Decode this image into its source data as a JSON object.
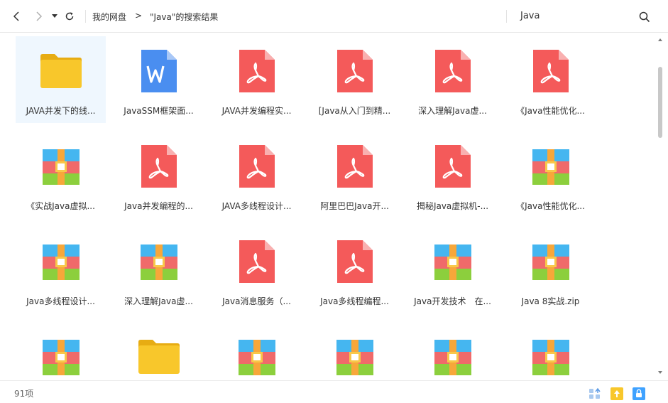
{
  "toolbar": {
    "back_icon": "chevron-left-icon",
    "forward_icon": "chevron-right-icon",
    "history_icon": "caret-down-icon",
    "refresh_icon": "refresh-icon"
  },
  "breadcrumb": {
    "root": "我的网盘",
    "separator": ">",
    "current": "\"Java\"的搜索结果"
  },
  "search": {
    "value": "Java",
    "icon": "search-icon"
  },
  "files": [
    {
      "name": "JAVA并发下的线...",
      "type": "folder",
      "selected": true
    },
    {
      "name": "JavaSSM框架面...",
      "type": "word"
    },
    {
      "name": "JAVA并发编程实...",
      "type": "pdf"
    },
    {
      "name": "[Java从入门到精...",
      "type": "pdf"
    },
    {
      "name": "深入理解Java虚...",
      "type": "pdf"
    },
    {
      "name": "《Java性能优化...",
      "type": "pdf"
    },
    {
      "name": "《实战Java虚拟...",
      "type": "zip"
    },
    {
      "name": "Java并发编程的...",
      "type": "pdf"
    },
    {
      "name": "JAVA多线程设计...",
      "type": "pdf"
    },
    {
      "name": "阿里巴巴Java开...",
      "type": "pdf"
    },
    {
      "name": "揭秘Java虚拟机-...",
      "type": "pdf"
    },
    {
      "name": "《Java性能优化...",
      "type": "zip"
    },
    {
      "name": "Java多线程设计...",
      "type": "zip"
    },
    {
      "name": "深入理解Java虚...",
      "type": "zip"
    },
    {
      "name": "Java消息服务（...",
      "type": "pdf"
    },
    {
      "name": "Java多线程编程...",
      "type": "pdf"
    },
    {
      "name": "Java开发技术　在...",
      "type": "zip"
    },
    {
      "name": "Java 8实战.zip",
      "type": "zip"
    },
    {
      "name": "",
      "type": "zip"
    },
    {
      "name": "",
      "type": "folder"
    },
    {
      "name": "",
      "type": "zip"
    },
    {
      "name": "",
      "type": "zip"
    },
    {
      "name": "",
      "type": "zip"
    },
    {
      "name": "",
      "type": "zip"
    }
  ],
  "status": {
    "count": "91项",
    "icons": [
      "view-toggle-icon",
      "upload-icon",
      "lock-icon"
    ]
  },
  "colors": {
    "pdf": "#f45a5a",
    "word": "#4a8ef0",
    "folder": "#f8c72b",
    "selected_bg": "#eff7fe",
    "accent": "#3fa2ff"
  }
}
